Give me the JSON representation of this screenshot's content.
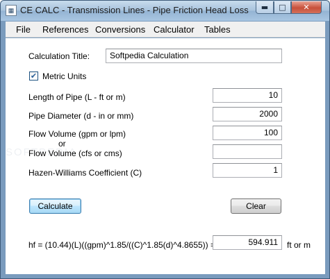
{
  "window": {
    "title": "CE CALC - Transmission Lines - Pipe Friction Head Loss",
    "app_icon": "calc-icon",
    "controls": {
      "minimize": "minimize-icon",
      "maximize": "maximize-icon",
      "close": "close-icon"
    }
  },
  "menu": [
    "File",
    "References",
    "Conversions",
    "Calculator",
    "Tables"
  ],
  "form": {
    "title_label": "Calculation Title:",
    "title_value": "Softpedia Calculation",
    "metric_label": "Metric Units",
    "metric_checked": true,
    "length_label": "Length of Pipe (L - ft or m)",
    "length_value": "10",
    "diameter_label": "Pipe Diameter (d - in or mm)",
    "diameter_value": "2000",
    "flow_gpm_label": "Flow Volume (gpm or lpm)",
    "flow_gpm_value": "100",
    "or_label": "or",
    "flow_cfs_label": "Flow Volume (cfs or cms)",
    "flow_cfs_value": "",
    "hazen_label": "Hazen-Williams Coefficient (C)",
    "hazen_value": "1",
    "calculate_button": "Calculate",
    "clear_button": "Clear",
    "formula_label": "hf = (10.44)(L)((gpm)^1.85/((C)^1.85(d)^4.8655)) =",
    "result_value": "594.911",
    "result_unit": "ft or m"
  },
  "watermark": "SOFTPEDIA"
}
